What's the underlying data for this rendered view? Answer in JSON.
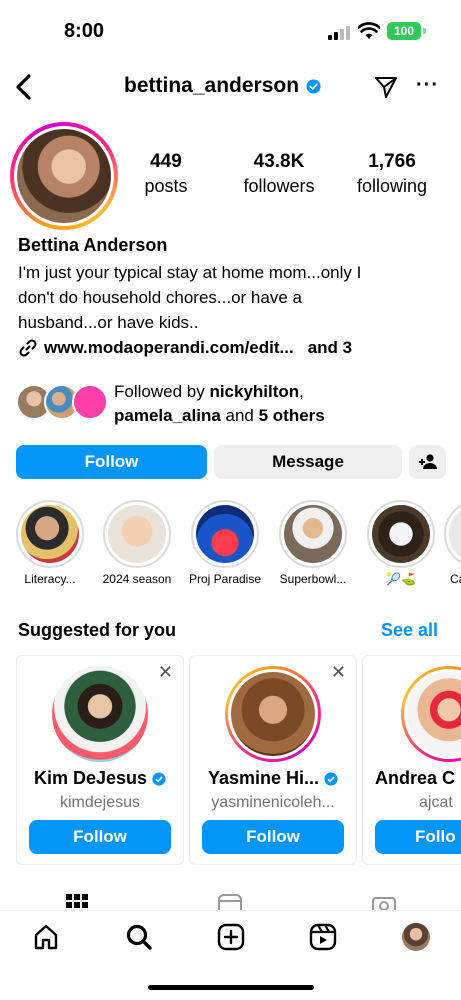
{
  "status_bar": {
    "time": "8:00",
    "battery": "100"
  },
  "header": {
    "username": "bettina_anderson",
    "icons": [
      "back-chevron-icon",
      "verified-badge-icon",
      "send-icon",
      "more-icon"
    ]
  },
  "profile": {
    "stats": [
      {
        "value": "449",
        "label": "posts"
      },
      {
        "value": "43.8K",
        "label": "followers"
      },
      {
        "value": "1,766",
        "label": "following"
      }
    ],
    "name": "Bettina Anderson",
    "bio_lines": [
      "I'm just your typical stay at home mom...only I",
      "don't do household chores...or have a",
      "husband...or have kids.."
    ],
    "link": "www.modaoperandi.com/edit...",
    "link_more": "and 3",
    "followed_by": {
      "prefix": "Followed by ",
      "user1": "nickyhilton",
      "sep1": ",",
      "user2": "pamela_alina",
      "mid": " and ",
      "others": "5 others"
    }
  },
  "actions": {
    "follow": "Follow",
    "message": "Message"
  },
  "highlights": [
    {
      "label": "Literacy..."
    },
    {
      "label": "2024 season"
    },
    {
      "label": "Proj Paradise"
    },
    {
      "label": "Superbowl..."
    },
    {
      "label": "🎾⛳"
    },
    {
      "label": "Ca"
    }
  ],
  "suggested": {
    "title": "Suggested for you",
    "see_all": "See all",
    "cards": [
      {
        "name": "Kim DeJesus",
        "handle": "kimdejesus",
        "verified": true,
        "follow": "Follow"
      },
      {
        "name": "Yasmine Hi...",
        "handle": "yasminenicoleh...",
        "verified": true,
        "follow": "Follow"
      },
      {
        "name": "Andrea C",
        "handle": "ajcat",
        "verified": false,
        "follow": "Follo"
      }
    ]
  },
  "bottom_nav": [
    "home-icon",
    "search-icon",
    "create-icon",
    "reels-icon",
    "profile-avatar"
  ],
  "colors": {
    "accent": "#0095f6",
    "battery": "#34c759",
    "secondary_bg": "#efefef",
    "muted_text": "#737373"
  }
}
